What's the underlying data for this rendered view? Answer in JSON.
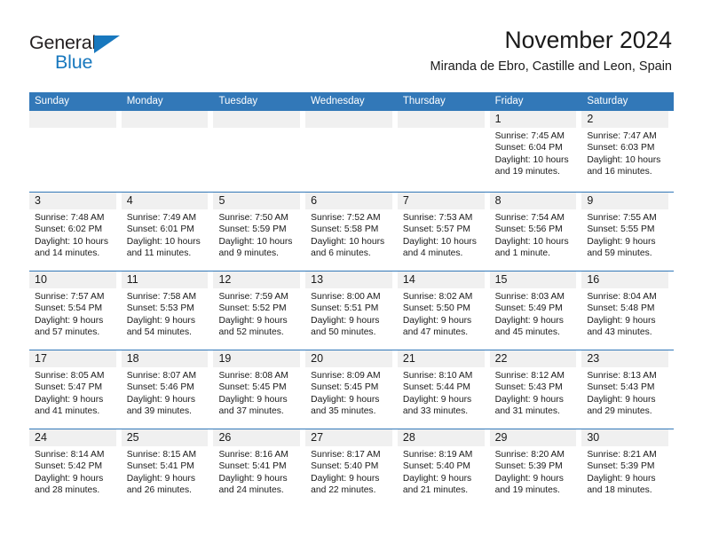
{
  "logo": {
    "text_top": "General",
    "text_bottom": "Blue",
    "triangle_icon": "blue-triangle-icon",
    "color_dark": "#231f20",
    "color_blue": "#1878be"
  },
  "header": {
    "title": "November 2024",
    "subtitle": "Miranda de Ebro, Castille and Leon, Spain"
  },
  "theme": {
    "header_blue": "#3278b8",
    "band_gray": "#f0f0f0",
    "text": "#1a1a1a"
  },
  "weekdays": [
    "Sunday",
    "Monday",
    "Tuesday",
    "Wednesday",
    "Thursday",
    "Friday",
    "Saturday"
  ],
  "weeks": [
    [
      {
        "day": "",
        "sunrise": "",
        "sunset": "",
        "daylight_1": "",
        "daylight_2": ""
      },
      {
        "day": "",
        "sunrise": "",
        "sunset": "",
        "daylight_1": "",
        "daylight_2": ""
      },
      {
        "day": "",
        "sunrise": "",
        "sunset": "",
        "daylight_1": "",
        "daylight_2": ""
      },
      {
        "day": "",
        "sunrise": "",
        "sunset": "",
        "daylight_1": "",
        "daylight_2": ""
      },
      {
        "day": "",
        "sunrise": "",
        "sunset": "",
        "daylight_1": "",
        "daylight_2": ""
      },
      {
        "day": "1",
        "sunrise": "Sunrise: 7:45 AM",
        "sunset": "Sunset: 6:04 PM",
        "daylight_1": "Daylight: 10 hours",
        "daylight_2": "and 19 minutes."
      },
      {
        "day": "2",
        "sunrise": "Sunrise: 7:47 AM",
        "sunset": "Sunset: 6:03 PM",
        "daylight_1": "Daylight: 10 hours",
        "daylight_2": "and 16 minutes."
      }
    ],
    [
      {
        "day": "3",
        "sunrise": "Sunrise: 7:48 AM",
        "sunset": "Sunset: 6:02 PM",
        "daylight_1": "Daylight: 10 hours",
        "daylight_2": "and 14 minutes."
      },
      {
        "day": "4",
        "sunrise": "Sunrise: 7:49 AM",
        "sunset": "Sunset: 6:01 PM",
        "daylight_1": "Daylight: 10 hours",
        "daylight_2": "and 11 minutes."
      },
      {
        "day": "5",
        "sunrise": "Sunrise: 7:50 AM",
        "sunset": "Sunset: 5:59 PM",
        "daylight_1": "Daylight: 10 hours",
        "daylight_2": "and 9 minutes."
      },
      {
        "day": "6",
        "sunrise": "Sunrise: 7:52 AM",
        "sunset": "Sunset: 5:58 PM",
        "daylight_1": "Daylight: 10 hours",
        "daylight_2": "and 6 minutes."
      },
      {
        "day": "7",
        "sunrise": "Sunrise: 7:53 AM",
        "sunset": "Sunset: 5:57 PM",
        "daylight_1": "Daylight: 10 hours",
        "daylight_2": "and 4 minutes."
      },
      {
        "day": "8",
        "sunrise": "Sunrise: 7:54 AM",
        "sunset": "Sunset: 5:56 PM",
        "daylight_1": "Daylight: 10 hours",
        "daylight_2": "and 1 minute."
      },
      {
        "day": "9",
        "sunrise": "Sunrise: 7:55 AM",
        "sunset": "Sunset: 5:55 PM",
        "daylight_1": "Daylight: 9 hours",
        "daylight_2": "and 59 minutes."
      }
    ],
    [
      {
        "day": "10",
        "sunrise": "Sunrise: 7:57 AM",
        "sunset": "Sunset: 5:54 PM",
        "daylight_1": "Daylight: 9 hours",
        "daylight_2": "and 57 minutes."
      },
      {
        "day": "11",
        "sunrise": "Sunrise: 7:58 AM",
        "sunset": "Sunset: 5:53 PM",
        "daylight_1": "Daylight: 9 hours",
        "daylight_2": "and 54 minutes."
      },
      {
        "day": "12",
        "sunrise": "Sunrise: 7:59 AM",
        "sunset": "Sunset: 5:52 PM",
        "daylight_1": "Daylight: 9 hours",
        "daylight_2": "and 52 minutes."
      },
      {
        "day": "13",
        "sunrise": "Sunrise: 8:00 AM",
        "sunset": "Sunset: 5:51 PM",
        "daylight_1": "Daylight: 9 hours",
        "daylight_2": "and 50 minutes."
      },
      {
        "day": "14",
        "sunrise": "Sunrise: 8:02 AM",
        "sunset": "Sunset: 5:50 PM",
        "daylight_1": "Daylight: 9 hours",
        "daylight_2": "and 47 minutes."
      },
      {
        "day": "15",
        "sunrise": "Sunrise: 8:03 AM",
        "sunset": "Sunset: 5:49 PM",
        "daylight_1": "Daylight: 9 hours",
        "daylight_2": "and 45 minutes."
      },
      {
        "day": "16",
        "sunrise": "Sunrise: 8:04 AM",
        "sunset": "Sunset: 5:48 PM",
        "daylight_1": "Daylight: 9 hours",
        "daylight_2": "and 43 minutes."
      }
    ],
    [
      {
        "day": "17",
        "sunrise": "Sunrise: 8:05 AM",
        "sunset": "Sunset: 5:47 PM",
        "daylight_1": "Daylight: 9 hours",
        "daylight_2": "and 41 minutes."
      },
      {
        "day": "18",
        "sunrise": "Sunrise: 8:07 AM",
        "sunset": "Sunset: 5:46 PM",
        "daylight_1": "Daylight: 9 hours",
        "daylight_2": "and 39 minutes."
      },
      {
        "day": "19",
        "sunrise": "Sunrise: 8:08 AM",
        "sunset": "Sunset: 5:45 PM",
        "daylight_1": "Daylight: 9 hours",
        "daylight_2": "and 37 minutes."
      },
      {
        "day": "20",
        "sunrise": "Sunrise: 8:09 AM",
        "sunset": "Sunset: 5:45 PM",
        "daylight_1": "Daylight: 9 hours",
        "daylight_2": "and 35 minutes."
      },
      {
        "day": "21",
        "sunrise": "Sunrise: 8:10 AM",
        "sunset": "Sunset: 5:44 PM",
        "daylight_1": "Daylight: 9 hours",
        "daylight_2": "and 33 minutes."
      },
      {
        "day": "22",
        "sunrise": "Sunrise: 8:12 AM",
        "sunset": "Sunset: 5:43 PM",
        "daylight_1": "Daylight: 9 hours",
        "daylight_2": "and 31 minutes."
      },
      {
        "day": "23",
        "sunrise": "Sunrise: 8:13 AM",
        "sunset": "Sunset: 5:43 PM",
        "daylight_1": "Daylight: 9 hours",
        "daylight_2": "and 29 minutes."
      }
    ],
    [
      {
        "day": "24",
        "sunrise": "Sunrise: 8:14 AM",
        "sunset": "Sunset: 5:42 PM",
        "daylight_1": "Daylight: 9 hours",
        "daylight_2": "and 28 minutes."
      },
      {
        "day": "25",
        "sunrise": "Sunrise: 8:15 AM",
        "sunset": "Sunset: 5:41 PM",
        "daylight_1": "Daylight: 9 hours",
        "daylight_2": "and 26 minutes."
      },
      {
        "day": "26",
        "sunrise": "Sunrise: 8:16 AM",
        "sunset": "Sunset: 5:41 PM",
        "daylight_1": "Daylight: 9 hours",
        "daylight_2": "and 24 minutes."
      },
      {
        "day": "27",
        "sunrise": "Sunrise: 8:17 AM",
        "sunset": "Sunset: 5:40 PM",
        "daylight_1": "Daylight: 9 hours",
        "daylight_2": "and 22 minutes."
      },
      {
        "day": "28",
        "sunrise": "Sunrise: 8:19 AM",
        "sunset": "Sunset: 5:40 PM",
        "daylight_1": "Daylight: 9 hours",
        "daylight_2": "and 21 minutes."
      },
      {
        "day": "29",
        "sunrise": "Sunrise: 8:20 AM",
        "sunset": "Sunset: 5:39 PM",
        "daylight_1": "Daylight: 9 hours",
        "daylight_2": "and 19 minutes."
      },
      {
        "day": "30",
        "sunrise": "Sunrise: 8:21 AM",
        "sunset": "Sunset: 5:39 PM",
        "daylight_1": "Daylight: 9 hours",
        "daylight_2": "and 18 minutes."
      }
    ]
  ]
}
